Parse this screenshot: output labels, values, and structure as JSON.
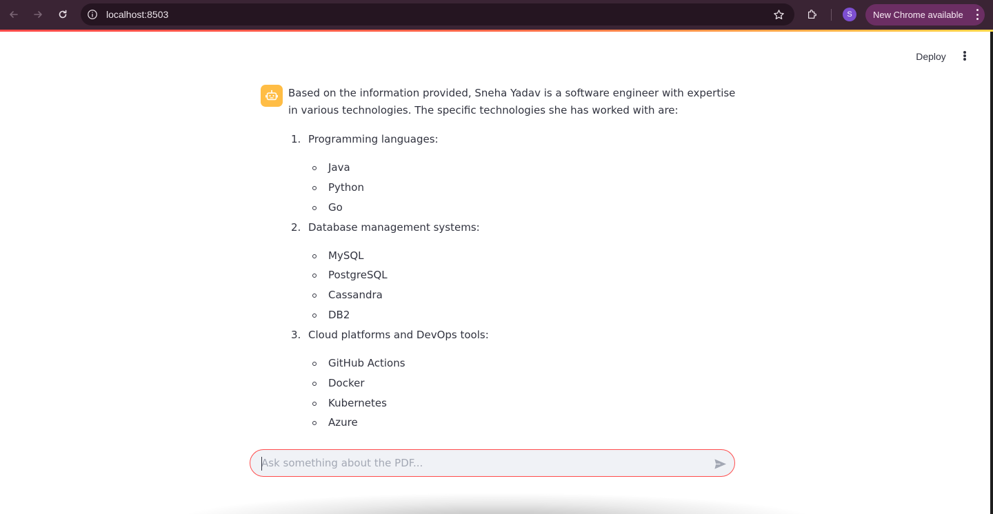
{
  "browser": {
    "url": "localhost:8503",
    "profile_initial": "S",
    "update_label": "New Chrome available"
  },
  "app_header": {
    "deploy_label": "Deploy"
  },
  "message": {
    "intro": "Based on the information provided, Sneha Yadav is a software engineer with expertise in various technologies. The specific technologies she has worked with are:",
    "sections": [
      {
        "num": "1.",
        "title": "Programming languages:",
        "items": [
          "Java",
          "Python",
          "Go"
        ]
      },
      {
        "num": "2.",
        "title": "Database management systems:",
        "items": [
          "MySQL",
          "PostgreSQL",
          "Cassandra",
          "DB2"
        ]
      },
      {
        "num": "3.",
        "title": "Cloud platforms and DevOps tools:",
        "items": [
          "GitHub Actions",
          "Docker",
          "Kubernetes",
          "Azure"
        ]
      }
    ]
  },
  "chat_input": {
    "placeholder": "Ask something about the PDF..."
  },
  "colors": {
    "accent": "#ff4b4b",
    "avatar": "#ffbd45",
    "text": "#31333f",
    "chrome_bar": "#3a2434"
  },
  "icons": [
    "back-arrow-icon",
    "forward-arrow-icon",
    "reload-icon",
    "site-info-icon",
    "bookmark-star-icon",
    "extensions-icon",
    "robot-icon",
    "send-icon"
  ]
}
